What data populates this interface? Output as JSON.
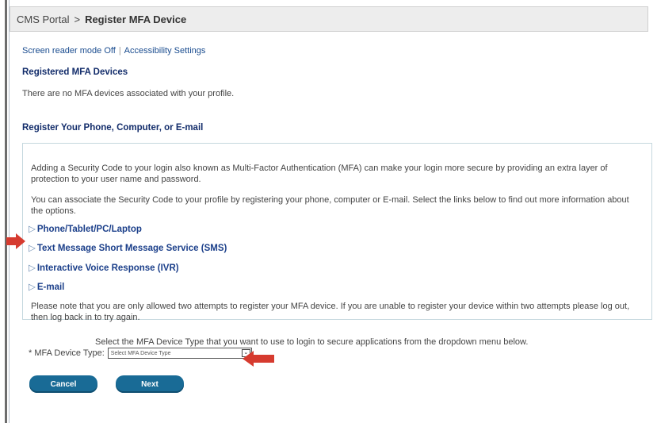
{
  "breadcrumb": {
    "portal": "CMS Portal",
    "separator": ">",
    "current": "Register MFA Device"
  },
  "top_links": {
    "screen_reader": "Screen reader mode Off",
    "accessibility": "Accessibility Settings"
  },
  "registered": {
    "heading": "Registered MFA Devices",
    "empty_message": "There are no MFA devices associated with your profile."
  },
  "register": {
    "heading": "Register Your Phone, Computer, or E-mail",
    "intro": "Adding a Security Code to your login also known as Multi-Factor Authentication (MFA) can make your login more secure by providing an extra layer of protection to your user name and password.",
    "instructions": "You can associate the Security Code to your profile by registering your phone, computer or E-mail. Select the links below to find out more information about the options.",
    "options": [
      {
        "label": "Phone/Tablet/PC/Laptop"
      },
      {
        "label": "Text Message Short Message Service (SMS)"
      },
      {
        "label": "Interactive Voice Response (IVR)"
      },
      {
        "label": "E-mail"
      }
    ],
    "note": "Please note that you are only allowed two attempts to register your MFA device. If you are unable to register your device within two attempts please log out, then log back in to try again."
  },
  "device_select": {
    "hint": "Select the MFA Device Type that you want to use to login to secure applications from the dropdown menu below.",
    "label": "* MFA Device Type:",
    "selected": "Select MFA Device Type"
  },
  "buttons": {
    "cancel": "Cancel",
    "next": "Next"
  },
  "colors": {
    "button": "#196b96",
    "heading": "#132d6b",
    "link": "#1b3f8a",
    "arrow": "#d63b2f"
  }
}
